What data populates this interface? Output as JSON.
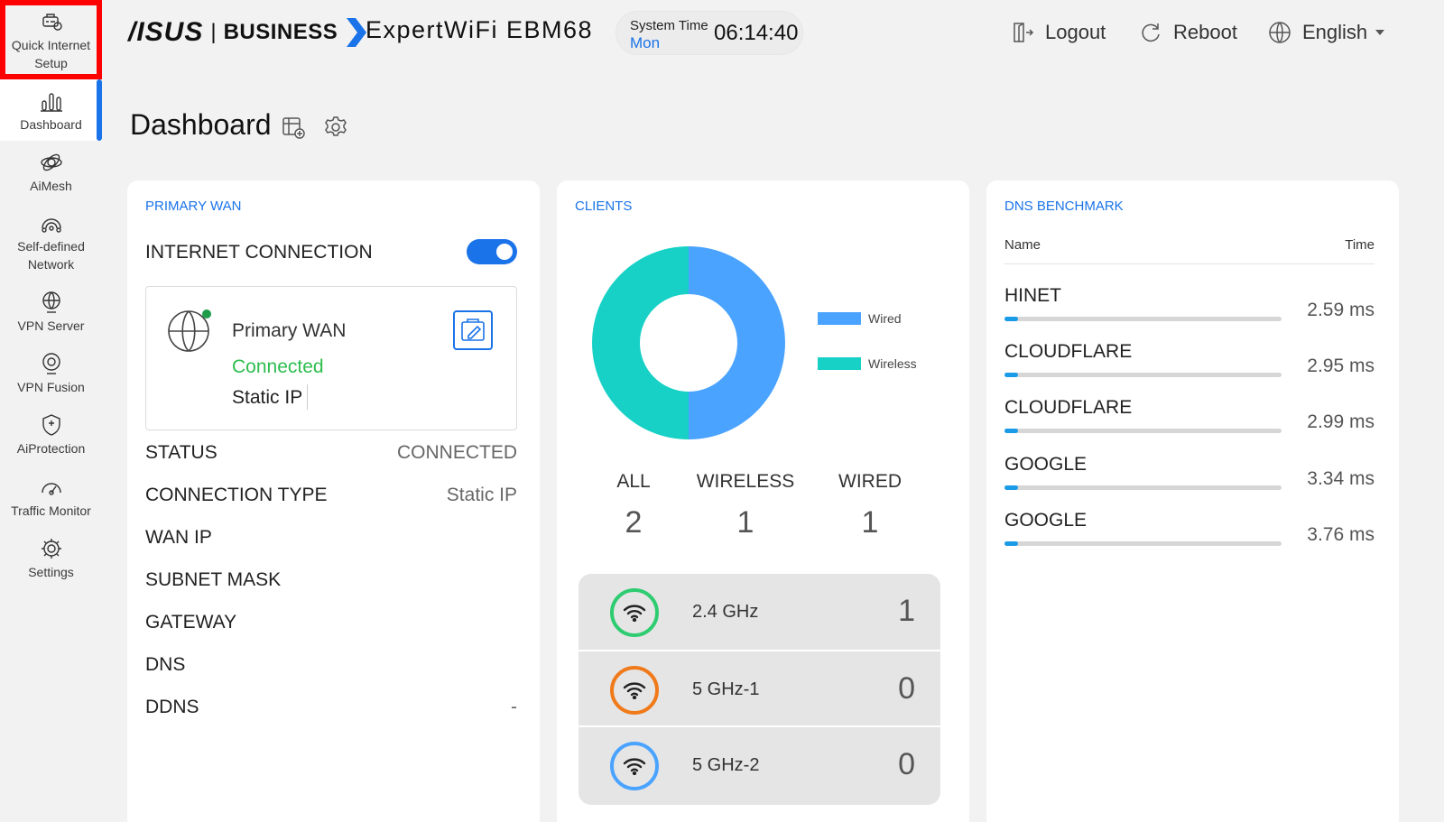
{
  "sidebar": {
    "items": [
      {
        "label_line1": "Quick Internet",
        "label_line2": "Setup",
        "icon": "quick-setup-icon"
      },
      {
        "label_line1": "Dashboard",
        "label_line2": "",
        "icon": "dashboard-icon"
      },
      {
        "label_line1": "AiMesh",
        "label_line2": "",
        "icon": "aimesh-icon"
      },
      {
        "label_line1": "Self-defined",
        "label_line2": "Network",
        "icon": "network-icon"
      },
      {
        "label_line1": "VPN Server",
        "label_line2": "",
        "icon": "vpn-server-icon"
      },
      {
        "label_line1": "VPN Fusion",
        "label_line2": "",
        "icon": "vpn-fusion-icon"
      },
      {
        "label_line1": "AiProtection",
        "label_line2": "",
        "icon": "shield-icon"
      },
      {
        "label_line1": "Traffic Monitor",
        "label_line2": "",
        "icon": "traffic-monitor-icon"
      },
      {
        "label_line1": "Settings",
        "label_line2": "",
        "icon": "gear-icon"
      }
    ],
    "active_index": 1,
    "highlight_index": 0,
    "accent": "#1a73e8",
    "highlight_color": "#ff0000"
  },
  "header": {
    "logo": "/ISUS",
    "separator": "|",
    "business": "BUSINESS",
    "model": "ExpertWiFi EBM68",
    "system_time_label": "System Time",
    "day": "Mon",
    "time": "06:14:40",
    "logout_label": "Logout",
    "reboot_label": "Reboot",
    "language_label": "English"
  },
  "page": {
    "title": "Dashboard"
  },
  "wan": {
    "section_title": "PRIMARY WAN",
    "internet_label": "INTERNET CONNECTION",
    "toggle_on": true,
    "box_name": "Primary WAN",
    "box_status": "Connected",
    "box_type": "Static IP",
    "rows": [
      {
        "label": "STATUS",
        "value": "CONNECTED"
      },
      {
        "label": "CONNECTION TYPE",
        "value": "Static IP"
      },
      {
        "label": "WAN IP",
        "value": ""
      },
      {
        "label": "SUBNET MASK",
        "value": ""
      },
      {
        "label": "GATEWAY",
        "value": ""
      },
      {
        "label": "DNS",
        "value": ""
      },
      {
        "label": "DDNS",
        "value": "-"
      }
    ]
  },
  "clients": {
    "section_title": "CLIENTS",
    "legend": [
      {
        "label": "Wired",
        "color": "#4aa3ff"
      },
      {
        "label": "Wireless",
        "color": "#17d1c6"
      }
    ],
    "counts": [
      {
        "label": "ALL",
        "value": "2"
      },
      {
        "label": "WIRELESS",
        "value": "1"
      },
      {
        "label": "WIRED",
        "value": "1"
      }
    ],
    "bands": [
      {
        "name": "2.4 GHz",
        "count": "1",
        "color": "#2ecc71"
      },
      {
        "name": "5 GHz-1",
        "count": "0",
        "color": "#f07a1a"
      },
      {
        "name": "5 GHz-2",
        "count": "0",
        "color": "#4aa3ff"
      }
    ]
  },
  "chart_data": {
    "type": "pie",
    "categories": [
      "Wired",
      "Wireless"
    ],
    "values": [
      1,
      1
    ],
    "title": "",
    "colors": [
      "#4aa3ff",
      "#17d1c6"
    ],
    "legend": "right"
  },
  "dns": {
    "section_title": "DNS BENCHMARK",
    "col_name": "Name",
    "col_time": "Time",
    "items": [
      {
        "name": "HINET",
        "time": "2.59 ms",
        "fill": 0.05
      },
      {
        "name": "CLOUDFLARE",
        "time": "2.95 ms",
        "fill": 0.05
      },
      {
        "name": "CLOUDFLARE",
        "time": "2.99 ms",
        "fill": 0.05
      },
      {
        "name": "GOOGLE",
        "time": "3.34 ms",
        "fill": 0.05
      },
      {
        "name": "GOOGLE",
        "time": "3.76 ms",
        "fill": 0.05
      }
    ]
  }
}
